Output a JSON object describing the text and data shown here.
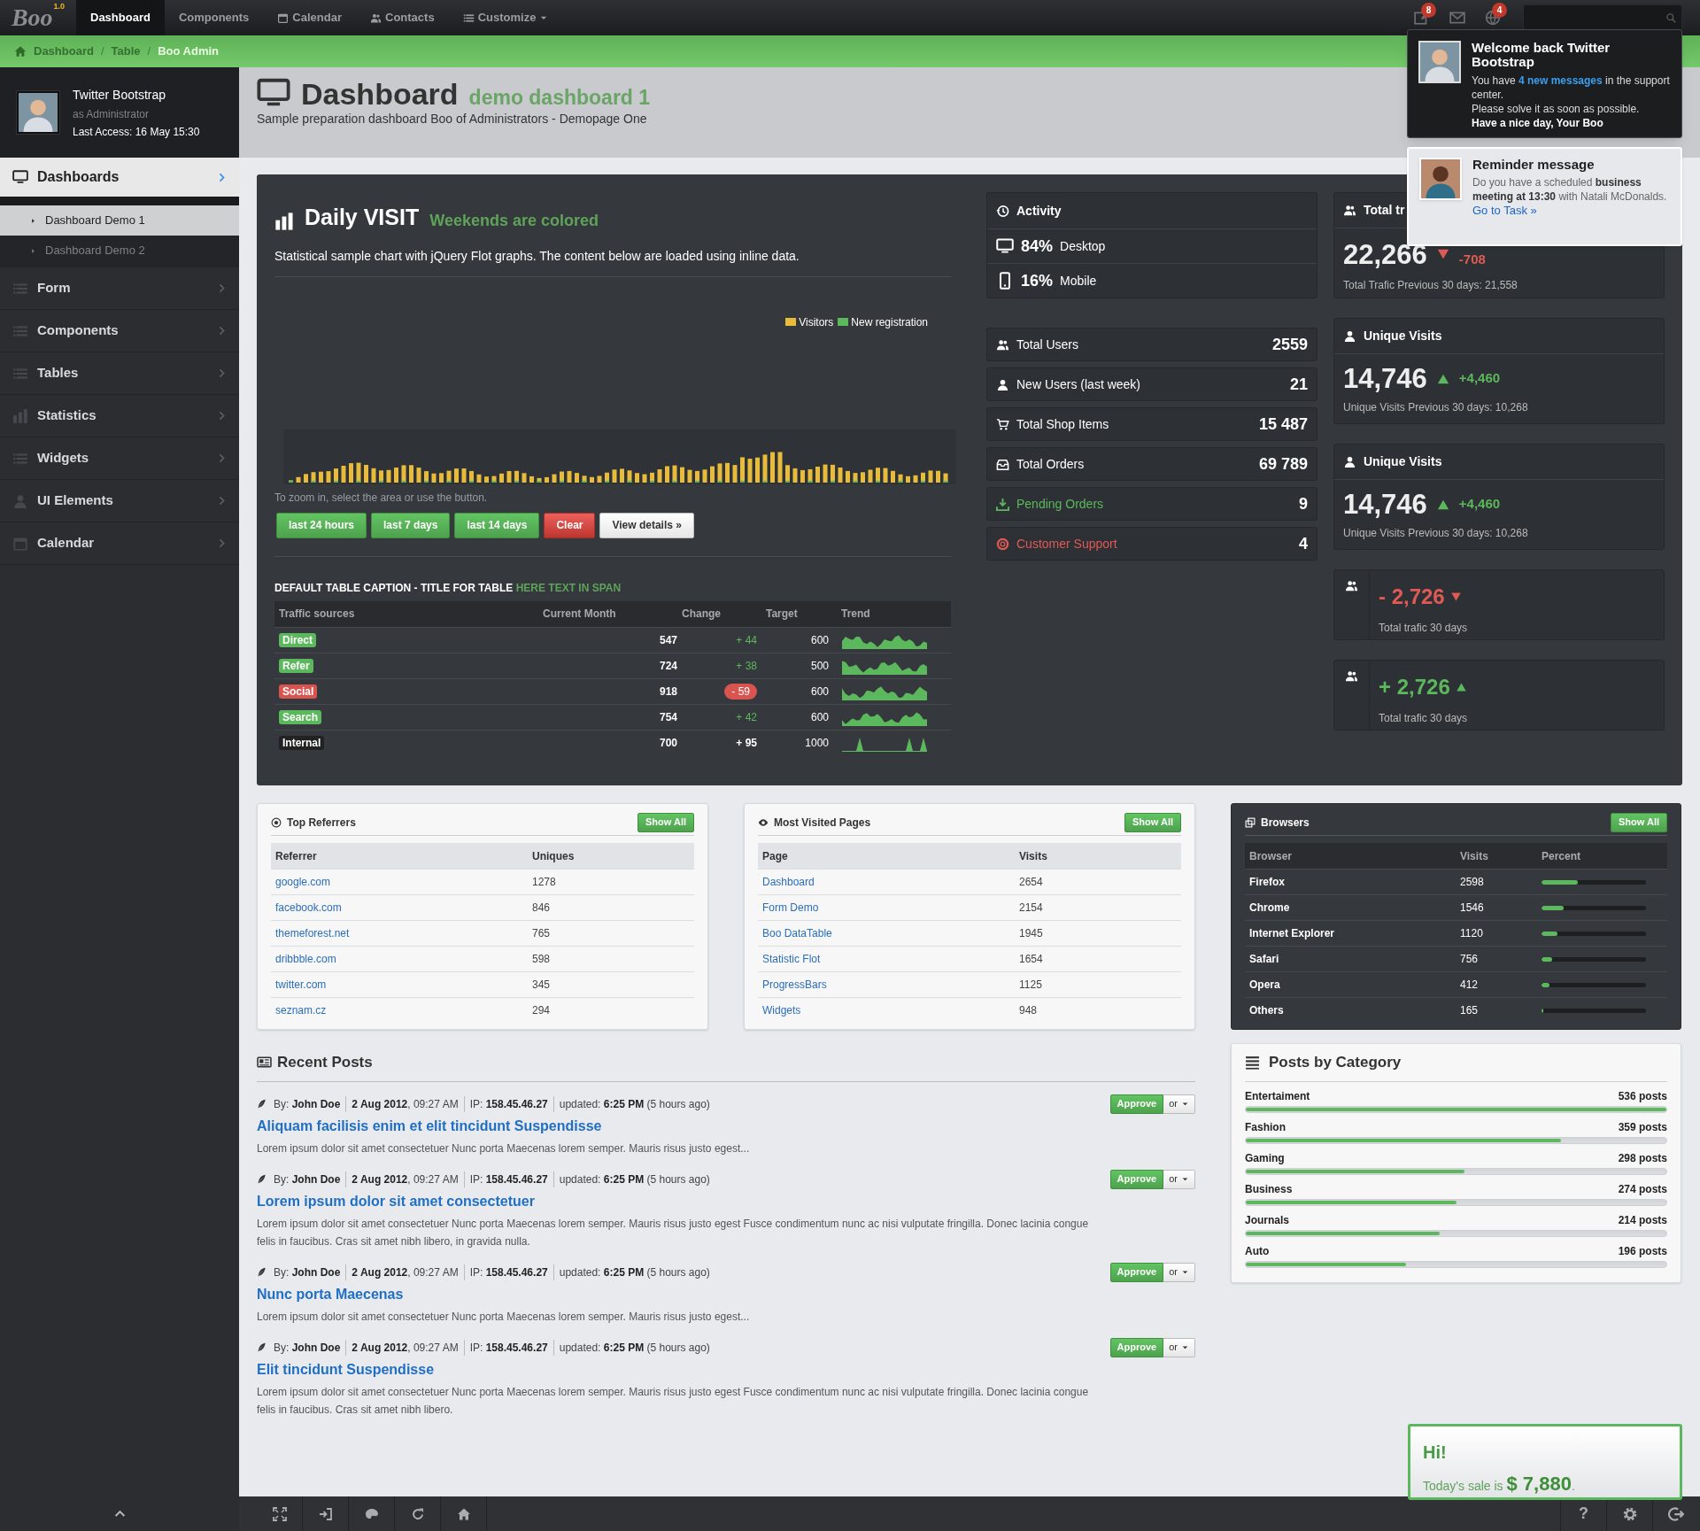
{
  "nav": {
    "logo": "Boo",
    "version": "1.0",
    "items": [
      {
        "label": "Dashboard",
        "selected": true,
        "dropdown": false
      },
      {
        "label": "Components",
        "selected": false,
        "dropdown": false
      },
      {
        "label": "Calendar",
        "selected": false,
        "dropdown": false
      },
      {
        "label": "Contacts",
        "selected": false,
        "dropdown": false
      },
      {
        "label": "Customize",
        "selected": false,
        "dropdown": true
      }
    ],
    "icons": [
      {
        "badge": "8",
        "unread": true
      },
      {
        "unread": false
      },
      {
        "badge": "4",
        "unread": true
      }
    ]
  },
  "breadcrumb": {
    "separator": "/",
    "items": [
      {
        "label": "Dashboard",
        "selected": false
      },
      {
        "label": "Table",
        "selected": false
      },
      {
        "label": "Boo Admin",
        "selected": true
      }
    ]
  },
  "user": {
    "name": "Twitter Bootstrap",
    "role": "as Administrator",
    "last_access": "Last Access: 16 May 15:30"
  },
  "sidebar": {
    "items": [
      {
        "label": "Dashboards",
        "selected": true,
        "expanded": true,
        "children": [
          {
            "label": "Dashboard Demo 1",
            "selected": true
          },
          {
            "label": "Dashboard Demo 2",
            "selected": false
          }
        ]
      },
      {
        "label": "Form",
        "selected": false,
        "expanded": false
      },
      {
        "label": "Components",
        "selected": false,
        "expanded": false
      },
      {
        "label": "Tables",
        "selected": false,
        "expanded": false
      },
      {
        "label": "Statistics",
        "selected": false,
        "expanded": false
      },
      {
        "label": "Widgets",
        "selected": false,
        "expanded": false
      },
      {
        "label": "UI Elements",
        "selected": false,
        "expanded": false
      },
      {
        "label": "Calendar",
        "selected": false,
        "expanded": false
      }
    ]
  },
  "header": {
    "title": "Dashboard",
    "subtitle": "demo dashboard 1",
    "description": "Sample preparation dashboard Boo of Administrators - Demopage One"
  },
  "daily": {
    "title": "Daily VISIT",
    "subtitle": "Weekends are colored",
    "description": "Statistical sample chart with jQuery Flot graphs. The content below are loaded using inline data.",
    "legend": [
      {
        "label": "Visitors",
        "color": "#e8bb3a"
      },
      {
        "label": "New registration",
        "color": "#5cb85c"
      }
    ],
    "hint": "To zoom in, select the area or use the button.",
    "buttons": [
      {
        "label": "last 24 hours",
        "kind": "success"
      },
      {
        "label": "last 7 days",
        "kind": "success"
      },
      {
        "label": "last 14 days",
        "kind": "success"
      },
      {
        "label": "Clear",
        "kind": "danger"
      },
      {
        "label": "View details »",
        "kind": "default"
      }
    ]
  },
  "traffic_table": {
    "caption": "DEFAULT TABLE CAPTION - TITLE FOR TABLE",
    "caption_span": "HERE TEXT IN SPAN",
    "columns": [
      "Traffic sources",
      "Current Month",
      "Change",
      "Target",
      "Trend"
    ],
    "rows": [
      {
        "source": "Direct",
        "kind": "positive",
        "current": "547",
        "change": "+ 44",
        "target": "600"
      },
      {
        "source": "Refer",
        "kind": "positive",
        "current": "724",
        "change": "+ 38",
        "target": "500"
      },
      {
        "source": "Social",
        "kind": "negative",
        "current": "918",
        "change": "- 59",
        "target": "600"
      },
      {
        "source": "Search",
        "kind": "positive",
        "current": "754",
        "change": "+ 42",
        "target": "600"
      },
      {
        "source": "Internal",
        "kind": "neutral",
        "current": "700",
        "change": "+ 95",
        "target": "1000"
      }
    ]
  },
  "activity": {
    "title": "Activity",
    "items": [
      {
        "value": "84%",
        "label": "Desktop"
      },
      {
        "value": "16%",
        "label": "Mobile"
      }
    ]
  },
  "stats": [
    {
      "label": "Total Users",
      "value": "2559",
      "kind": "normal"
    },
    {
      "label": "New Users (last week)",
      "value": "21",
      "kind": "normal"
    },
    {
      "label": "Total Shop Items",
      "value": "15 487",
      "kind": "normal"
    },
    {
      "label": "Total Orders",
      "value": "69 789",
      "kind": "normal"
    },
    {
      "label": "Pending Orders",
      "value": "9",
      "kind": "success"
    },
    {
      "label": "Customer Support",
      "value": "4",
      "kind": "danger"
    }
  ],
  "traffic_cards": [
    {
      "title": "Total tr",
      "value": "22,266",
      "change": "-708",
      "rising": false,
      "footer": "Total Trafic Previous 30 days: 21,558"
    },
    {
      "title": "Unique Visits",
      "value": "14,746",
      "change": "+4,460",
      "rising": true,
      "footer": "Unique Visits Previous 30 days: 10,268"
    },
    {
      "title": "Unique Visits",
      "value": "14,746",
      "change": "+4,460",
      "rising": true,
      "footer": "Unique Visits Previous 30 days: 10,268"
    }
  ],
  "compact_cards": [
    {
      "value": "- 2,726",
      "rising": false,
      "footer": "Total trafic 30 days"
    },
    {
      "value": "+ 2,726",
      "rising": true,
      "footer": "Total trafic 30 days"
    }
  ],
  "referrers": {
    "title": "Top Referrers",
    "button": "Show All",
    "columns": [
      "Referrer",
      "Uniques"
    ],
    "rows": [
      [
        "google.com",
        "1278"
      ],
      [
        "facebook.com",
        "846"
      ],
      [
        "themeforest.net",
        "765"
      ],
      [
        "dribbble.com",
        "598"
      ],
      [
        "twitter.com",
        "345"
      ],
      [
        "seznam.cz",
        "294"
      ]
    ]
  },
  "pages": {
    "title": "Most Visited Pages",
    "button": "Show All",
    "columns": [
      "Page",
      "Visits"
    ],
    "rows": [
      [
        "Dashboard",
        "2654"
      ],
      [
        "Form Demo",
        "2154"
      ],
      [
        "Boo DataTable",
        "1945"
      ],
      [
        "Statistic Flot",
        "1654"
      ],
      [
        "ProgressBars",
        "1125"
      ],
      [
        "Widgets",
        "948"
      ]
    ]
  },
  "browsers": {
    "title": "Browsers",
    "button": "Show All",
    "columns": [
      "Browser",
      "Visits",
      "Percent"
    ],
    "rows": [
      {
        "name": "Firefox",
        "visits": "2598",
        "level": 0.35
      },
      {
        "name": "Chrome",
        "visits": "1546",
        "level": 0.21
      },
      {
        "name": "Internet Explorer",
        "visits": "1120",
        "level": 0.15
      },
      {
        "name": "Safari",
        "visits": "756",
        "level": 0.1
      },
      {
        "name": "Opera",
        "visits": "412",
        "level": 0.08
      },
      {
        "name": "Others",
        "visits": "165",
        "level": 0.02
      }
    ]
  },
  "recent_posts": {
    "title": "Recent Posts",
    "posts": [
      {
        "meta": [
          "By: **John Doe**",
          "**2 Aug 2012**, 09:27 AM",
          "IP: **158.45.46.27**",
          "updated: **6:25 PM** (5 hours ago)"
        ],
        "title": "Aliquam facilisis enim et elit tincidunt Suspendisse",
        "excerpt": "Lorem ipsum dolor sit amet consectetuer Nunc porta Maecenas lorem semper. Mauris risus justo egest...",
        "approve": "Approve",
        "more": "or"
      },
      {
        "meta": [
          "By: **John Doe**",
          "**2 Aug 2012**, 09:27 AM",
          "IP: **158.45.46.27**",
          "updated: **6:25 PM** (5 hours ago)"
        ],
        "title": "Lorem ipsum dolor sit amet consectetuer",
        "excerpt": "Lorem ipsum dolor sit amet consectetuer Nunc porta Maecenas lorem semper. Mauris risus justo egest Fusce condimentum nunc ac nisi vulputate fringilla. Donec lacinia congue felis in faucibus. Cras sit amet nibh libero, in gravida nulla.",
        "approve": "Approve",
        "more": "or"
      },
      {
        "meta": [
          "By: **John Doe**",
          "**2 Aug 2012**, 09:27 AM",
          "IP: **158.45.46.27**",
          "updated: **6:25 PM** (5 hours ago)"
        ],
        "title": "Nunc porta Maecenas",
        "excerpt": "Lorem ipsum dolor sit amet consectetuer Nunc porta Maecenas lorem semper. Mauris risus justo egest...",
        "approve": "Approve",
        "more": "or"
      },
      {
        "meta": [
          "By: **John Doe**",
          "**2 Aug 2012**, 09:27 AM",
          "IP: **158.45.46.27**",
          "updated: **6:25 PM** (5 hours ago)"
        ],
        "title": "Elit tincidunt Suspendisse",
        "excerpt": "Lorem ipsum dolor sit amet consectetuer Nunc porta Maecenas lorem semper. Mauris risus justo egest Fusce condimentum nunc ac nisi vulputate fringilla. Donec lacinia congue felis in faucibus. Cras sit amet nibh libero.",
        "approve": "Approve",
        "more": "or"
      }
    ]
  },
  "categories": {
    "title": "Posts by Category",
    "items": [
      {
        "label": "Entertaiment",
        "count": "536 posts",
        "level": 1.0
      },
      {
        "label": "Fashion",
        "count": "359 posts",
        "level": 0.75
      },
      {
        "label": "Gaming",
        "count": "298 posts",
        "level": 0.52
      },
      {
        "label": "Business",
        "count": "274 posts",
        "level": 0.5
      },
      {
        "label": "Journals",
        "count": "214 posts",
        "level": 0.46
      },
      {
        "label": "Auto",
        "count": "196 posts",
        "level": 0.38
      }
    ]
  },
  "welcome": {
    "title": "Welcome back Twitter Bootstrap",
    "before": "You have ",
    "link": "4 new messages",
    "after": " in the support center.",
    "line": "Please solve it as soon as possible.",
    "signoff": "Have a nice day, Your Boo"
  },
  "reminder": {
    "title": "Reminder message",
    "text": "Do you have a scheduled **business meeting at 13:30** with Natali McDonalds.",
    "link": "Go to Task »"
  },
  "sale": {
    "title": "Hi!",
    "text": "Today's sale is **$ 7,880**."
  },
  "bottom_bar": {
    "help": "?"
  }
}
